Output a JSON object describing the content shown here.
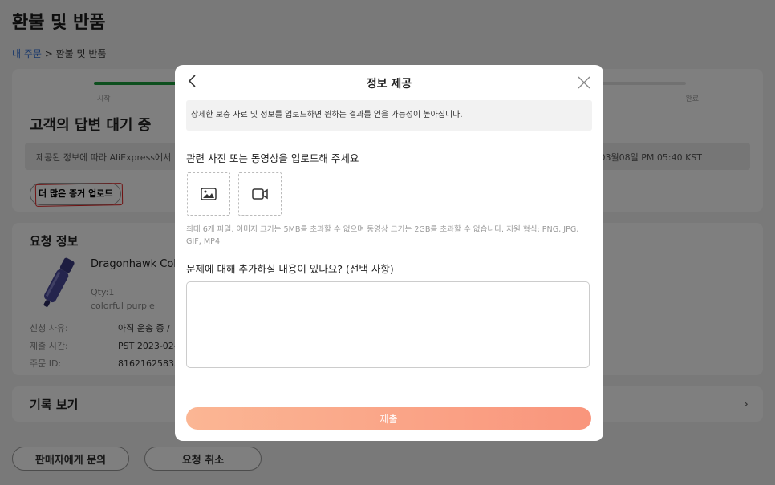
{
  "page": {
    "title": "환불 및 반품",
    "breadcrumb": {
      "link": "내 주문",
      "separator": " > ",
      "current": "환불 및 반품"
    }
  },
  "progress": {
    "fill_fraction": 0.45,
    "start_label": "시작",
    "end_label": "완료",
    "accent": "#1a9f3d"
  },
  "status": {
    "heading": "고객의 답변 대기 중",
    "info_text_start": "제공된 정보에 따라 AliExpress에서",
    "info_text_end": "03월08일 PM 05:40 KST",
    "upload_button": "더 많은 증거 업로드"
  },
  "request_info": {
    "title": "요청 정보",
    "product": {
      "name": "Dragonhawk Colo",
      "qty": "Qty:1",
      "color": "colorful purple"
    },
    "rows": [
      {
        "label": "신청 사유:",
        "value": "아직 운송 중 /"
      },
      {
        "label": "제출 시간:",
        "value": "PST 2023-02-1"
      },
      {
        "label": "주문 ID:",
        "value": "81621625833"
      }
    ]
  },
  "history": {
    "title": "기록 보기"
  },
  "bottom_buttons": {
    "contact_seller": "판매자에게 문의",
    "cancel_request": "요청 취소"
  },
  "modal": {
    "title": "정보 제공",
    "notice": "상세한 보충 자료 및 정보를 업로드하면 원하는 결과를 얻을 가능성이 높아집니다.",
    "upload_label": "관련 사진 또는 동영상을 업로드해 주세요",
    "upload_hint": "최대 6개 파일. 이미지 크기는 5MB를 초과할 수 없으며 동영상 크기는 2GB를 초과할 수 없습니다. 지원 형식: PNG, JPG, GIF, MP4.",
    "details_label": "문제에 대해 추가하실 내용이 있나요? (선택 사항)",
    "details_value": "",
    "submit": "제출",
    "icons": {
      "back": "chevron-left-icon",
      "close": "close-icon",
      "image": "image-icon",
      "video": "video-icon"
    }
  }
}
